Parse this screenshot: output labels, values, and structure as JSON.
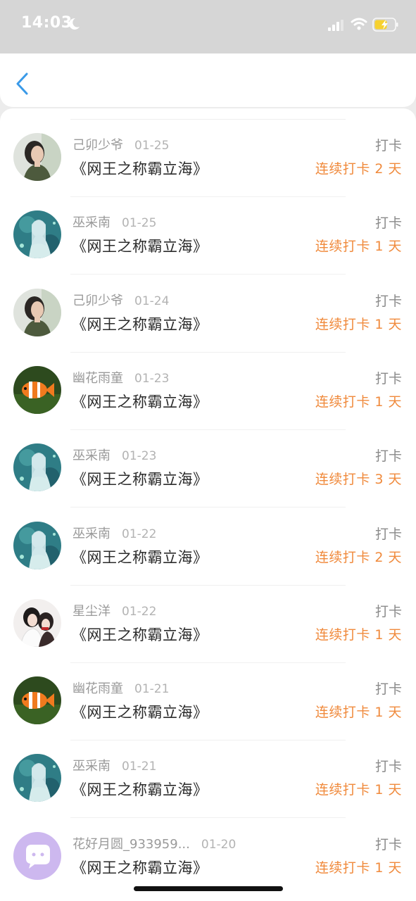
{
  "status_bar": {
    "time": "14:03"
  },
  "nav": {
    "back_icon": "chevron-left-icon"
  },
  "colors": {
    "streak": "#f08a3c",
    "back": "#3a9ae8"
  },
  "items": [
    {
      "name": "己卯少爷",
      "date": "01-25",
      "title": "《网王之称霸立海》",
      "action": "打卡",
      "streak": "连续打卡 2 天",
      "avatar": "girl"
    },
    {
      "name": "巫采南",
      "date": "01-25",
      "title": "《网王之称霸立海》",
      "action": "打卡",
      "streak": "连续打卡 1 天",
      "avatar": "anime"
    },
    {
      "name": "己卯少爷",
      "date": "01-24",
      "title": "《网王之称霸立海》",
      "action": "打卡",
      "streak": "连续打卡 1 天",
      "avatar": "girl"
    },
    {
      "name": "幽花雨童",
      "date": "01-23",
      "title": "《网王之称霸立海》",
      "action": "打卡",
      "streak": "连续打卡 1 天",
      "avatar": "fish"
    },
    {
      "name": "巫采南",
      "date": "01-23",
      "title": "《网王之称霸立海》",
      "action": "打卡",
      "streak": "连续打卡 3 天",
      "avatar": "anime"
    },
    {
      "name": "巫采南",
      "date": "01-22",
      "title": "《网王之称霸立海》",
      "action": "打卡",
      "streak": "连续打卡 2 天",
      "avatar": "anime"
    },
    {
      "name": "星尘洋",
      "date": "01-22",
      "title": "《网王之称霸立海》",
      "action": "打卡",
      "streak": "连续打卡 1 天",
      "avatar": "couple"
    },
    {
      "name": "幽花雨童",
      "date": "01-21",
      "title": "《网王之称霸立海》",
      "action": "打卡",
      "streak": "连续打卡 1 天",
      "avatar": "fish"
    },
    {
      "name": "巫采南",
      "date": "01-21",
      "title": "《网王之称霸立海》",
      "action": "打卡",
      "streak": "连续打卡 1 天",
      "avatar": "anime"
    },
    {
      "name": "花好月圆_933959...",
      "date": "01-20",
      "title": "《网王之称霸立海》",
      "action": "打卡",
      "streak": "连续打卡 1 天",
      "avatar": "default"
    }
  ]
}
